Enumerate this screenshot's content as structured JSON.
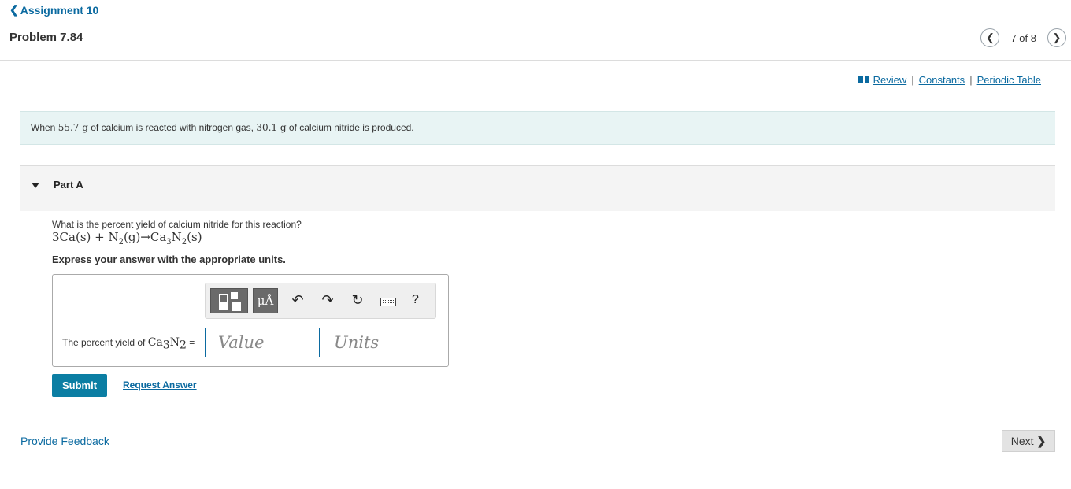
{
  "header": {
    "back_label": "Assignment 10",
    "back_icon": "chevron-left-icon",
    "problem_title": "Problem 7.84",
    "pager": {
      "prev_icon": "chevron-left-icon",
      "count": "7 of 8",
      "next_icon": "chevron-right-icon"
    }
  },
  "resources": {
    "icon": "book-icon",
    "links": [
      "Review",
      "Constants",
      "Periodic Table"
    ],
    "separator": "|"
  },
  "intro": {
    "text_1": "When ",
    "mass_1": "55.7 g",
    "text_2": " of calcium is reacted with nitrogen gas, ",
    "mass_2": "30.1 g",
    "text_3": " of calcium nitride is produced."
  },
  "part": {
    "toggle_icon": "triangle-down-icon",
    "label": "Part A",
    "question": "What is the percent yield of calcium nitride for this reaction?",
    "equation": {
      "lhs": "3Ca(s) + N",
      "n_sub": "2",
      "mid": "(g)→Ca",
      "ca_sub": "3",
      "n": "N",
      "n2_sub": "2",
      "rhs": "(s)"
    },
    "instruction": "Express your answer with the appropriate units."
  },
  "answer": {
    "toolbar": {
      "template_icon": "template-icon",
      "units_label": "μÅ",
      "undo_icon": "undo-icon",
      "redo_icon": "redo-icon",
      "reset_icon": "reset-icon",
      "keyboard_icon": "keyboard-icon",
      "help_label": "?"
    },
    "label_prefix": "The percent yield of ",
    "label_formula_ca": "Ca",
    "label_sub_3": "3",
    "label_formula_n": "N",
    "label_sub_2": "2",
    "label_suffix": " =",
    "value_placeholder": "Value",
    "units_placeholder": "Units"
  },
  "actions": {
    "submit_label": "Submit",
    "request_label": "Request Answer"
  },
  "footer": {
    "feedback_label": "Provide Feedback",
    "next_label": "Next",
    "next_icon": "chevron-right-icon"
  },
  "colors": {
    "accent": "#0b7ea3",
    "link": "#0b6aa0",
    "intro_bg": "#e8f4f4"
  }
}
